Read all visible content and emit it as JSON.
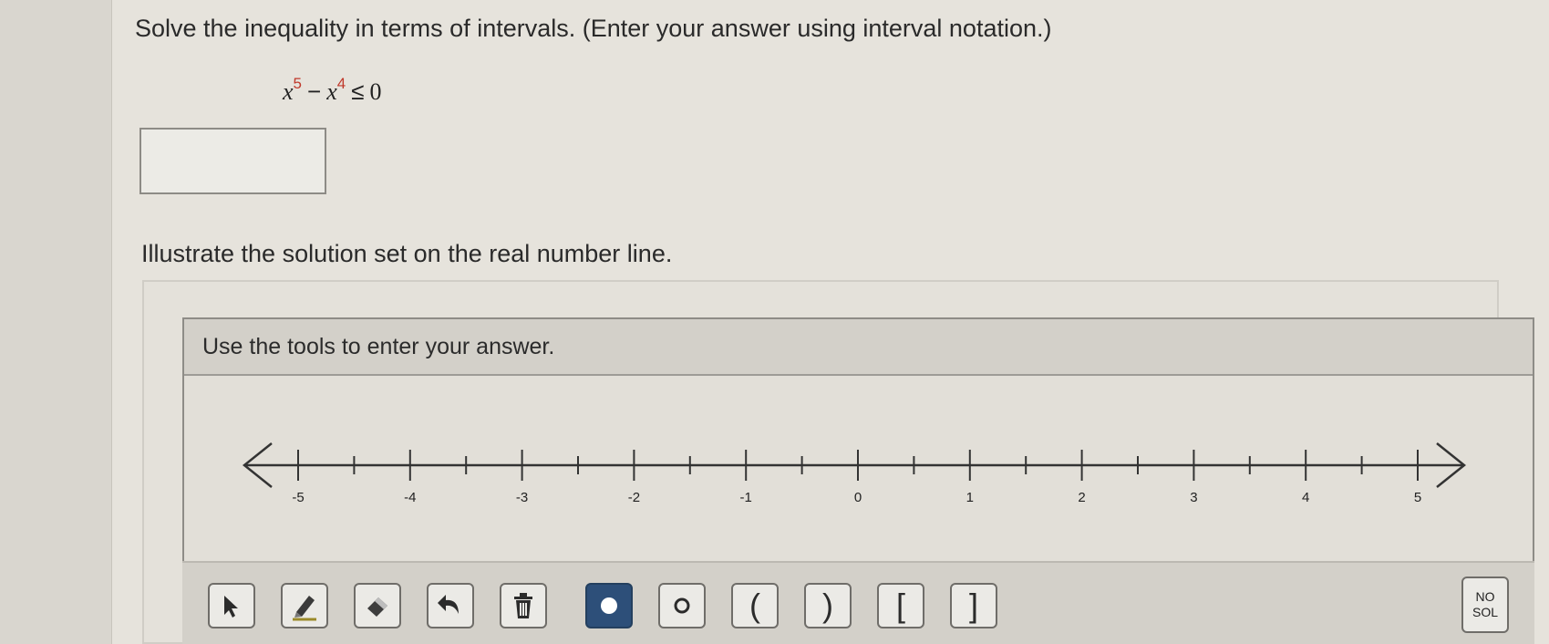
{
  "question": {
    "prompt": "Solve the inequality in terms of intervals. (Enter your answer using interval notation.)",
    "inequality": {
      "var1": "x",
      "exp1": "5",
      "minus": "−",
      "var2": "x",
      "exp2": "4",
      "relation": "≤",
      "rhs": "0"
    },
    "answer_value": ""
  },
  "illustrate": {
    "prompt": "Illustrate the solution set on the real number line."
  },
  "tool_panel": {
    "header": "Use the tools to enter your answer."
  },
  "number_line": {
    "labels": [
      "-5",
      "-4",
      "-3",
      "-2",
      "-1",
      "0",
      "1",
      "2",
      "3",
      "4",
      "5"
    ]
  },
  "toolbar": {
    "buttons": [
      {
        "name": "select-tool-button",
        "icon": "arrow-cursor-icon"
      },
      {
        "name": "pencil-tool-button",
        "icon": "pencil-icon"
      },
      {
        "name": "eraser-tool-button",
        "icon": "eraser-icon"
      },
      {
        "name": "undo-button",
        "icon": "undo-icon"
      },
      {
        "name": "delete-button",
        "icon": "trash-icon"
      },
      {
        "name": "closed-point-button",
        "icon": "filled-dot-icon",
        "selected": true
      },
      {
        "name": "open-point-button",
        "icon": "open-dot-icon"
      },
      {
        "name": "open-left-paren-button",
        "label": "("
      },
      {
        "name": "open-right-paren-button",
        "label": ")"
      },
      {
        "name": "closed-left-bracket-button",
        "label": "["
      },
      {
        "name": "closed-right-bracket-button",
        "label": "]"
      }
    ],
    "no_solution": {
      "line1": "NO",
      "line2": "SOL"
    }
  },
  "colors": {
    "exponent": "#c0392b",
    "selected_tool": "#2d4f79"
  }
}
